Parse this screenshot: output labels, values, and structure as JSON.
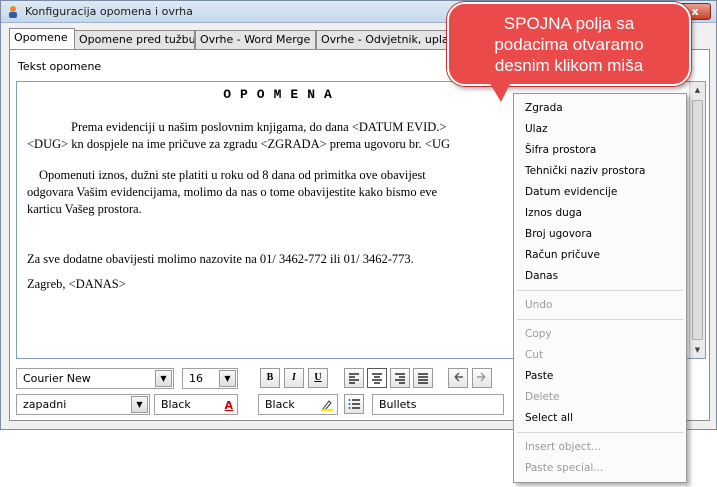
{
  "window": {
    "title": "Konfiguracija opomena i ovrha",
    "close_glyph": "x"
  },
  "tabs": [
    {
      "label": "Opomene"
    },
    {
      "label": "Opomene pred tužbu"
    },
    {
      "label": "Ovrhe - Word Merge"
    },
    {
      "label": "Ovrhe - Odvjetnik, uplatnic"
    }
  ],
  "editor": {
    "label": "Tekst opomene",
    "heading": "OPOMENA",
    "lines": [
      "Prema evidenciji u našim poslovnim knjigama, do dana <DATUM EVID.>",
      "<DUG> kn dospjele na ime pričuve za zgradu <ZGRADA> prema ugovoru br. <UG",
      "Opomenuti iznos, dužni ste platiti u roku od 8 dana od primitka ove obavijest",
      "odgovara Vašim evidencijama, molimo da nas o tome obavijestite kako bismo eve",
      "karticu Vašeg prostora.",
      "Za sve dodatne obavijesti molimo nazovite na 01/ 3462-772 ili 01/ 3462-773.",
      "Zagreb, <DANAS>"
    ]
  },
  "toolbar": {
    "font_name": "Courier New",
    "font_size": "16",
    "bold": "B",
    "italic": "I",
    "underline": "U",
    "charset": "zapadni",
    "font_color": "Black",
    "font_color_letter": "A",
    "highlight_color": "Black",
    "bullets": "Bullets"
  },
  "callout": {
    "line1": "SPOJNA polja sa",
    "line2": "podacima otvaramo",
    "line3": "desnim klikom miša"
  },
  "context_menu": {
    "items": [
      {
        "label": "Zgrada",
        "enabled": true
      },
      {
        "label": "Ulaz",
        "enabled": true
      },
      {
        "label": "Šifra prostora",
        "enabled": true
      },
      {
        "label": "Tehnički naziv prostora",
        "enabled": true
      },
      {
        "label": "Datum evidencije",
        "enabled": true
      },
      {
        "label": "Iznos duga",
        "enabled": true
      },
      {
        "label": "Broj ugovora",
        "enabled": true
      },
      {
        "label": "Račun pričuve",
        "enabled": true
      },
      {
        "label": "Danas",
        "enabled": true
      },
      {
        "label": "Undo",
        "enabled": false
      },
      {
        "label": "Copy",
        "enabled": false
      },
      {
        "label": "Cut",
        "enabled": false
      },
      {
        "label": "Paste",
        "enabled": true
      },
      {
        "label": "Delete",
        "enabled": false
      },
      {
        "label": "Select all",
        "enabled": true
      },
      {
        "label": "Insert object...",
        "enabled": false
      },
      {
        "label": "Paste special...",
        "enabled": false
      }
    ]
  },
  "colors": {
    "callout": "#ea4a4a",
    "close_button": "#c7432d",
    "highlight_swatch": "#ffe400",
    "font_color_swatch": "#d00000"
  }
}
